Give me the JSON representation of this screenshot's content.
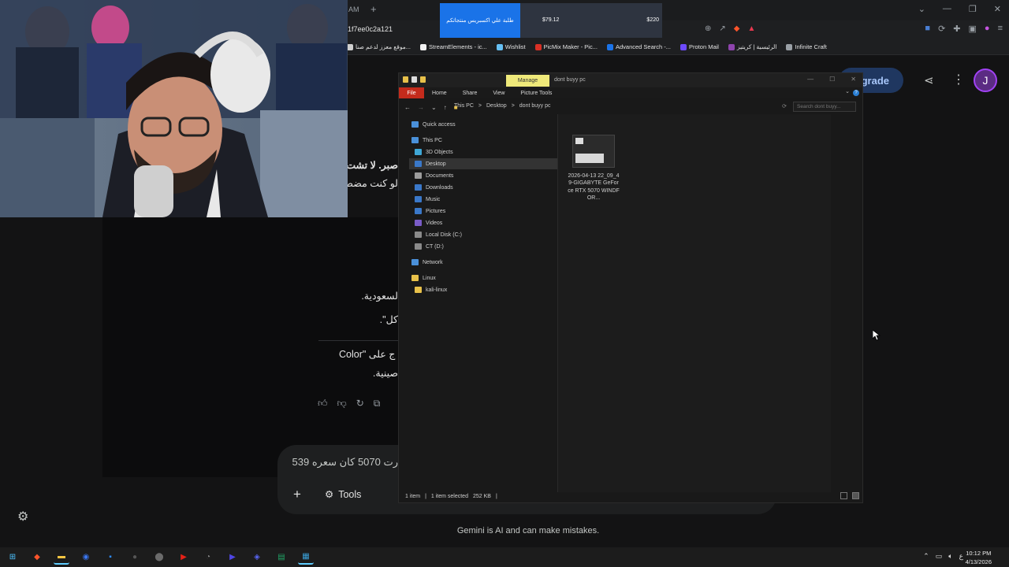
{
  "browser": {
    "tab_url_fragment": "AM",
    "new_tab_symbol": "+",
    "address_fragment": "1f7ee0c2a121",
    "price_overlay": {
      "banner": "طلبة علي اكسبريس منتجاتكم",
      "price_1": "$79.12",
      "price_2": "$220"
    },
    "window_controls": [
      "⌄",
      "—",
      "❐",
      "✕"
    ],
    "bookmarks": [
      {
        "label": "موقع معزز لدعم صنا...",
        "color": "#cfcfcf"
      },
      {
        "label": "StreamElements - ic...",
        "color": "#f2f2f2"
      },
      {
        "label": "Wishlist",
        "color": "#66c0f4"
      },
      {
        "label": "PicMix Maker - Pic...",
        "color": "#d93025"
      },
      {
        "label": "Advanced Search -...",
        "color": "#1a73e8"
      },
      {
        "label": "Proton Mail",
        "color": "#6d4aff"
      },
      {
        "label": "الرئيسية | كريتيز",
        "color": "#8e44ad"
      },
      {
        "label": "Infinite Craft",
        "color": "#9aa0a6"
      }
    ]
  },
  "gemini": {
    "upgrade_label": "grade",
    "avatar_letter": "J",
    "chat_fragments": [
      "صبر. لا تشت",
      "لو كنت مضط",
      "لسعودية.",
      "كل\".",
      "Color\" ج على",
      "صينية."
    ],
    "prompt_text": "رت 5070 كان سعره 539",
    "plus_symbol": "+",
    "tools_label": "Tools",
    "disclaimer": "Gemini is AI and can make mistakes."
  },
  "explorer": {
    "manage_label": "Manage",
    "window_title": "dont buyy pc",
    "ribbon_tabs": [
      "Home",
      "Share",
      "View",
      "Picture Tools"
    ],
    "file_tab": "File",
    "breadcrumb": [
      "This PC",
      ">",
      "Desktop",
      ">",
      "dont buyy pc"
    ],
    "search_placeholder": "Search dont buyy...",
    "sidebar": [
      {
        "label": "Quick access",
        "indent": 0,
        "color": "#4a90d9"
      },
      {
        "label": "This PC",
        "indent": 0,
        "color": "#4a90d9"
      },
      {
        "label": "3D Objects",
        "indent": 1,
        "color": "#3fa7d6"
      },
      {
        "label": "Desktop",
        "indent": 1,
        "color": "#3a78c9"
      },
      {
        "label": "Documents",
        "indent": 1,
        "color": "#9c9c9c"
      },
      {
        "label": "Downloads",
        "indent": 1,
        "color": "#3a78c9"
      },
      {
        "label": "Music",
        "indent": 1,
        "color": "#3a78c9"
      },
      {
        "label": "Pictures",
        "indent": 1,
        "color": "#3a78c9"
      },
      {
        "label": "Videos",
        "indent": 1,
        "color": "#7a5cc7"
      },
      {
        "label": "Local Disk (C:)",
        "indent": 1,
        "color": "#8a8a8a"
      },
      {
        "label": "CT (D:)",
        "indent": 1,
        "color": "#8a8a8a"
      },
      {
        "label": "Network",
        "indent": 0,
        "color": "#4a90d9"
      },
      {
        "label": "Linux",
        "indent": 0,
        "color": "#e8c14a"
      },
      {
        "label": "kali-linux",
        "indent": 1,
        "color": "#e8c14a"
      }
    ],
    "selected_sidebar_item": "Desktop",
    "file": {
      "name": "2026-04-13 22_09_49-GIGABYTE GeForce RTX 5070 WINDFOR..."
    },
    "status": {
      "count": "1 item",
      "selected": "1 item selected",
      "size": "252 KB"
    }
  },
  "taskbar": {
    "apps": [
      {
        "name": "windows-start",
        "color": "#4cc2ff"
      },
      {
        "name": "brave-browser",
        "color": "#fb542b"
      },
      {
        "name": "file-explorer",
        "color": "#f5c542"
      },
      {
        "name": "signal",
        "color": "#3a76f0"
      },
      {
        "name": "notepad",
        "color": "#2d8cff"
      },
      {
        "name": "obs-studio",
        "color": "#555555"
      },
      {
        "name": "steam",
        "color": "#6b6b6b"
      },
      {
        "name": "youtube",
        "color": "#e62117"
      },
      {
        "name": "performance-monitor",
        "color": "#888888"
      },
      {
        "name": "media-player",
        "color": "#4f46e5"
      },
      {
        "name": "discord",
        "color": "#5865f2"
      },
      {
        "name": "spreadsheet",
        "color": "#21a366"
      },
      {
        "name": "photos",
        "color": "#3aa0d8"
      }
    ],
    "tray": {
      "language": "ع"
    },
    "clock": {
      "time": "10:12 PM",
      "date": "4/13/2026"
    }
  }
}
